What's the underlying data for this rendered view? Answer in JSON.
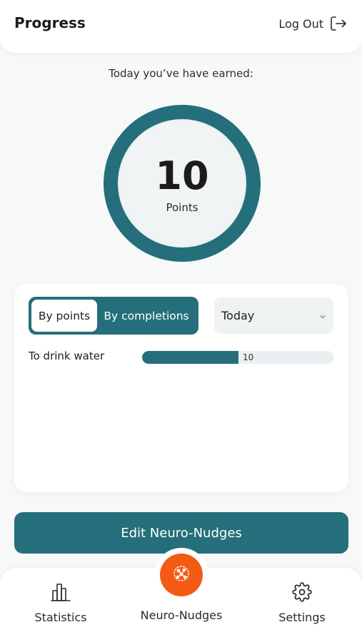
{
  "header": {
    "title": "Progress",
    "logout_label": "Log Out",
    "logout_icon": "logout-icon"
  },
  "summary": {
    "earned_label": "Today you’ve have earned:",
    "points_value": "10",
    "points_label": "Points"
  },
  "filters": {
    "toggle_options": [
      "By points",
      "By completions"
    ],
    "active_option": "By points",
    "period_selected": "Today",
    "period_icon": "chevron-down-icon"
  },
  "habits": [
    {
      "label": "To drink water",
      "value": "10",
      "fill_fraction": 0.5
    }
  ],
  "actions": {
    "edit_label": "Edit Neuro-Nudges"
  },
  "nav": {
    "items": [
      {
        "label": "Statistics",
        "icon": "bar-chart-icon"
      },
      {
        "label": "Neuro-Nudges",
        "icon": "neuro-nudges-icon"
      },
      {
        "label": "Settings",
        "icon": "gear-icon"
      }
    ]
  },
  "colors": {
    "primary": "#246f7b",
    "accent": "#f35b14"
  }
}
